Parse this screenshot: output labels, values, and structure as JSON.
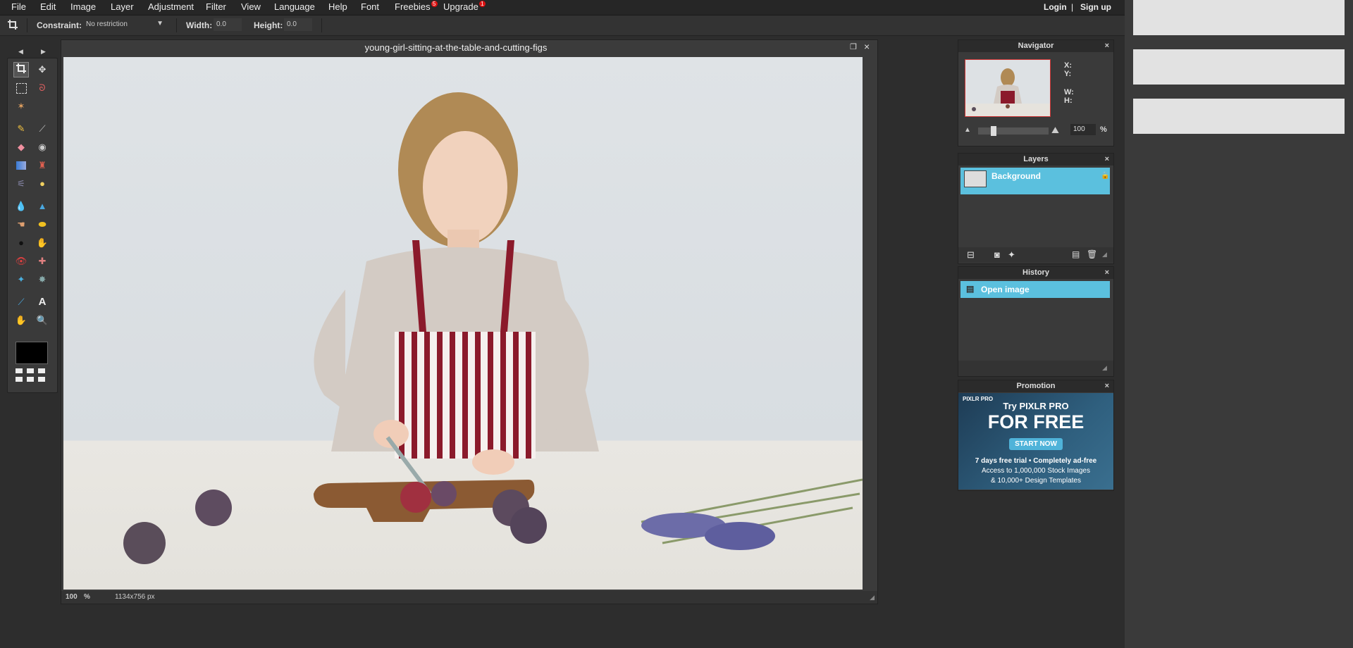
{
  "menu": {
    "items": [
      "File",
      "Edit",
      "Image",
      "Layer",
      "Adjustment",
      "Filter",
      "View",
      "Language",
      "Help",
      "Font"
    ],
    "freebies": {
      "label": "Freebies",
      "badge": "5"
    },
    "upgrade": {
      "label": "Upgrade",
      "badge": "1"
    },
    "login": "Login",
    "separator": "|",
    "signup": "Sign up"
  },
  "options": {
    "constraint_label": "Constraint:",
    "constraint_value": "No restriction",
    "width_label": "Width:",
    "width_value": "0.0",
    "height_label": "Height:",
    "height_value": "0.0"
  },
  "document": {
    "title": "young-girl-sitting-at-the-table-and-cutting-figs",
    "zoom": "100",
    "zoom_unit": "%",
    "size": "1134x756 px"
  },
  "navigator": {
    "title": "Navigator",
    "x_label": "X:",
    "y_label": "Y:",
    "w_label": "W:",
    "h_label": "H:",
    "zoom_value": "100",
    "zoom_unit": "%",
    "zoom_fraction": 0.2
  },
  "layers": {
    "title": "Layers",
    "items": [
      {
        "name": "Background",
        "locked": true
      }
    ]
  },
  "history": {
    "title": "History",
    "items": [
      "Open image"
    ]
  },
  "promotion": {
    "title": "Promotion",
    "brand": "PIXLR PRO",
    "line1": "Try PIXLR PRO",
    "line2": "FOR FREE",
    "button": "START NOW",
    "line3": "7 days free trial",
    "bullet": "•",
    "line3b": "Completely ad-free",
    "line4": "Access to 1,000,000 Stock Images",
    "line5": "& 10,000+ Design Templates"
  },
  "close_symbol": "×",
  "colors": {
    "accent": "#5bc0de",
    "badge": "#dd1111",
    "foreground": "#000000"
  },
  "icons": [
    "crop-icon",
    "move-icon",
    "marquee-icon",
    "lasso-icon",
    "wand-icon",
    "pencil-icon",
    "brush-icon",
    "eraser-icon",
    "bucket-icon",
    "gradient-icon",
    "stamp-icon",
    "color-replace-icon",
    "drawing-icon",
    "blur-icon",
    "sharpen-icon",
    "smudge-icon",
    "sponge-icon",
    "dodge-icon",
    "burn-icon",
    "red-eye-icon",
    "spot-heal-icon",
    "bloat-icon",
    "pinch-icon",
    "color-picker-icon",
    "type-icon",
    "hand-icon",
    "zoom-icon"
  ]
}
